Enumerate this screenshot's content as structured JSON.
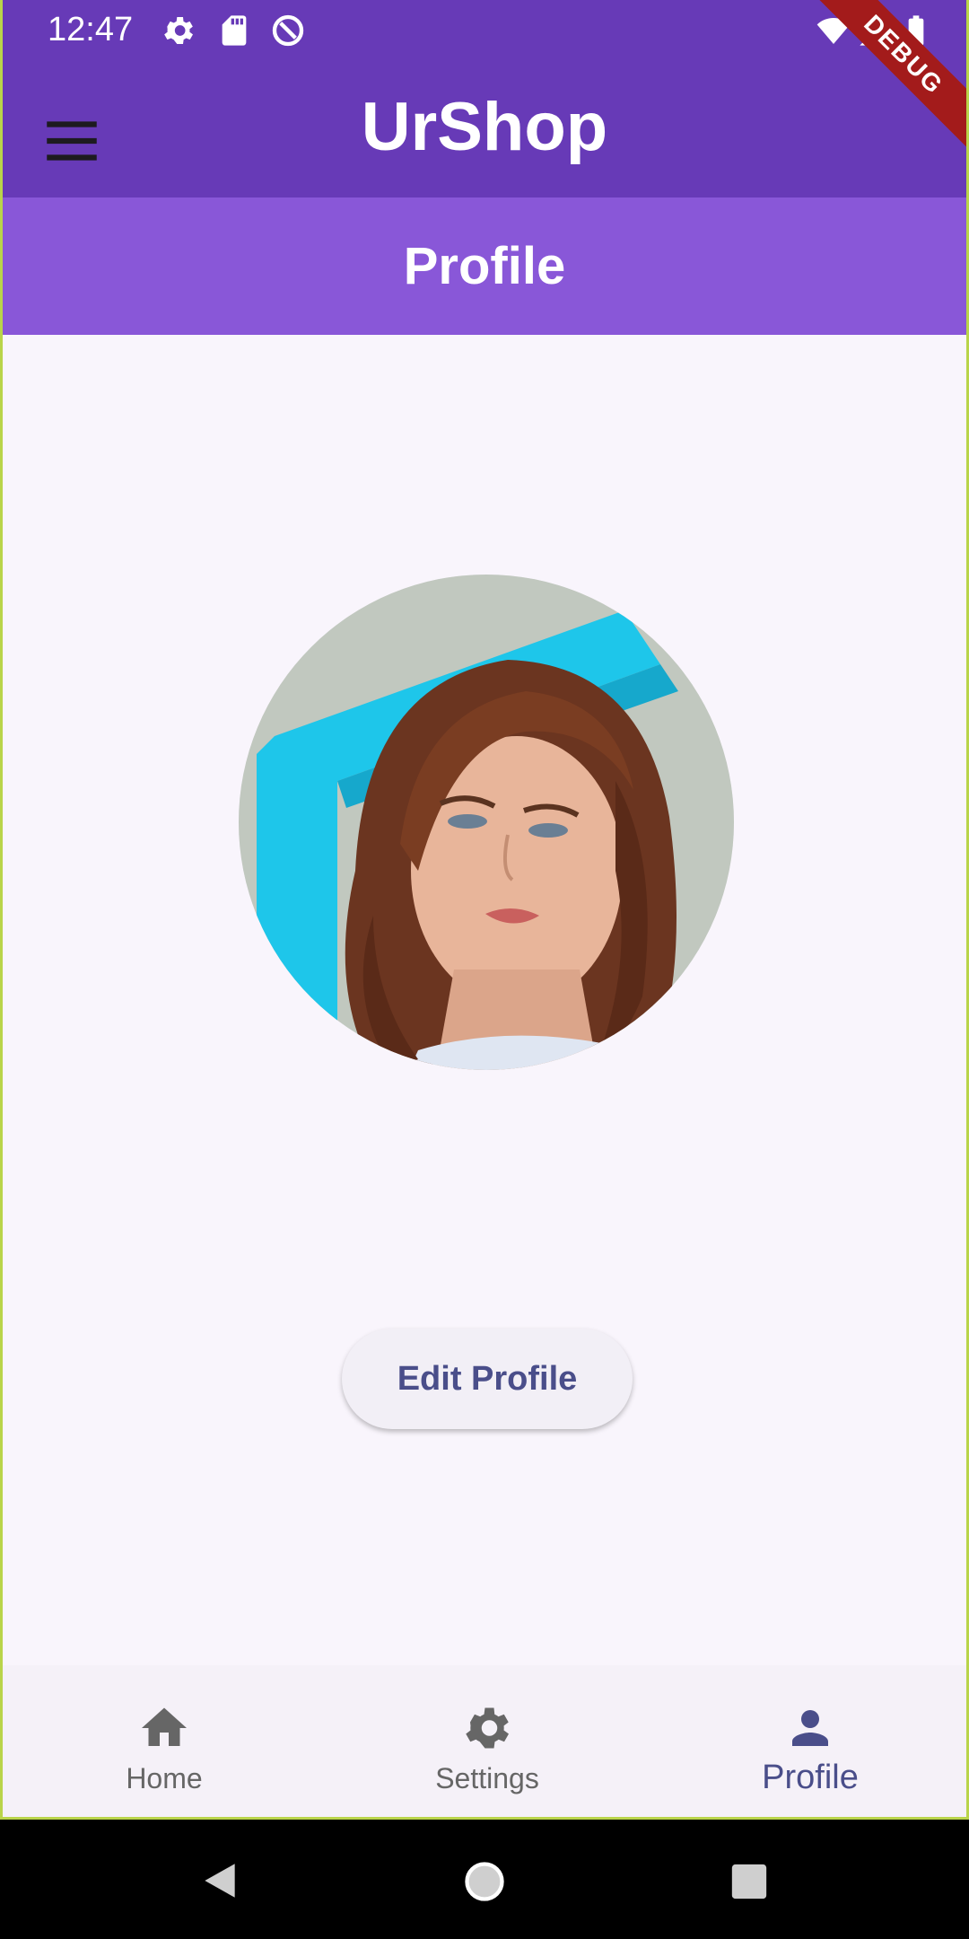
{
  "status": {
    "time": "12:47",
    "icons": [
      "gear-icon",
      "sd-card-icon",
      "data-saver-icon",
      "wifi-icon",
      "signal-icon",
      "battery-icon"
    ]
  },
  "appbar": {
    "title": "UrShop",
    "menu_icon": "menu-icon"
  },
  "debug_banner": "DEBUG",
  "page": {
    "title": "Profile"
  },
  "profile": {
    "edit_label": "Edit Profile"
  },
  "bottom_nav": {
    "items": [
      {
        "label": "Home",
        "icon": "home-icon",
        "active": false
      },
      {
        "label": "Settings",
        "icon": "settings-icon",
        "active": false
      },
      {
        "label": "Profile",
        "icon": "person-icon",
        "active": true
      }
    ]
  },
  "colors": {
    "primary": "#673ab7",
    "subheader": "#8957d8",
    "background": "#f9f5fc",
    "active_nav": "#4a4e8a",
    "inactive_nav": "#666666"
  }
}
